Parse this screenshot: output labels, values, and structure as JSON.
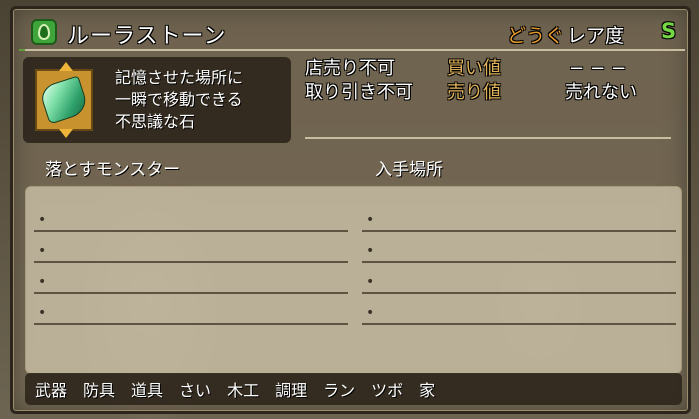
{
  "header": {
    "item_name": "ルーラストーン",
    "category": "どうぐ",
    "rarity_label": "レア度",
    "rarity_value": "S",
    "badge_icon": "leaf-icon"
  },
  "item": {
    "icon": "green-gem-icon",
    "description": "記憶させた場所に\n一瞬で移動できる\n不思議な石"
  },
  "trade": {
    "shop_sell": "店売り不可",
    "trade_status": "取り引き不可",
    "buy_label": "買い値",
    "sell_label": "売り値",
    "buy_price": "−−−",
    "sell_price": "売れない"
  },
  "sections": {
    "monsters_header": "落とすモンスター",
    "location_header": "入手場所"
  },
  "monster_rows": [
    "",
    "",
    "",
    ""
  ],
  "location_rows": [
    "",
    "",
    "",
    ""
  ],
  "tabs": [
    "武器",
    "防具",
    "道具",
    "さい",
    "木工",
    "調理",
    "ラン",
    "ツボ",
    "家"
  ],
  "colors": {
    "category": "#e69a2c",
    "rarity": "#73d843",
    "price_label": "#e0b25a"
  }
}
